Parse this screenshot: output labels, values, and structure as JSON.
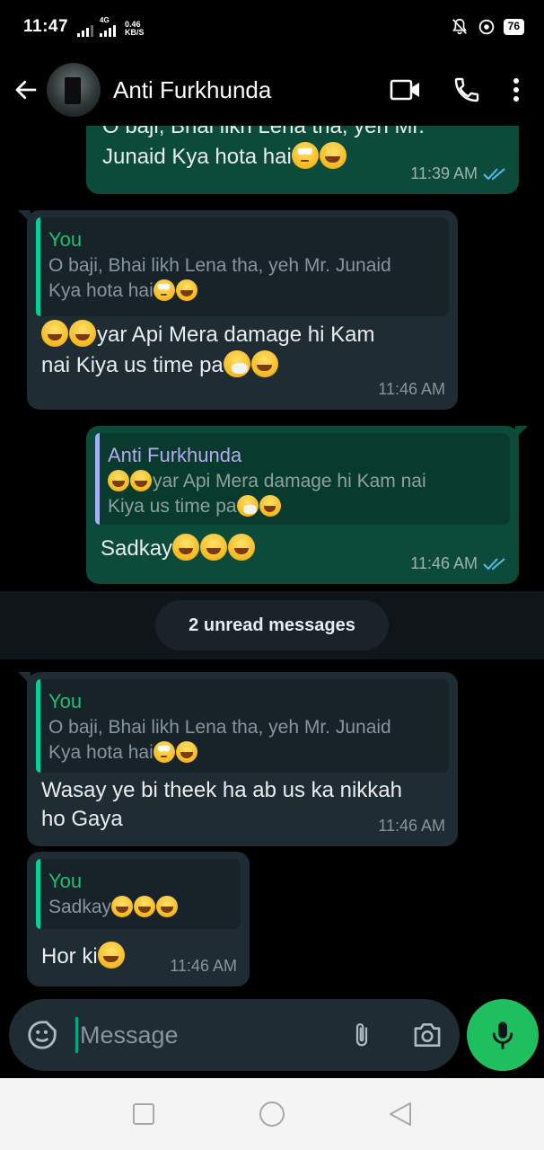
{
  "status_bar": {
    "time": "11:47",
    "network_type": "4G",
    "net_speed_value": "0.46",
    "net_speed_unit": "KB/S",
    "battery": "76"
  },
  "header": {
    "contact_name": "Anti Furkhunda",
    "icons": [
      "back-arrow-icon",
      "video-call-icon",
      "phone-icon",
      "more-vert-icon"
    ]
  },
  "messages": [
    {
      "direction": "out",
      "text_line1": "O baji, Bhai likh Lena tha,  yeh Mr.",
      "text_line2": "Junaid Kya hota hai",
      "time": "11:39 AM",
      "status": "read"
    },
    {
      "direction": "in",
      "quote_author": "You",
      "quote_line1": "O baji, Bhai likh Lena tha,  yeh Mr. Junaid",
      "quote_line2": "Kya hota hai",
      "text_line1": "yar Api Mera damage hi Kam",
      "text_line2": "nai Kiya us time pa",
      "time": "11:46 AM"
    },
    {
      "direction": "out",
      "quote_author": "Anti Furkhunda",
      "quote_line1": "yar Api Mera damage hi Kam nai",
      "quote_line2": "Kiya us time pa",
      "text": "Sadkay",
      "time": "11:46 AM",
      "status": "read"
    },
    {
      "direction": "in",
      "quote_author": "You",
      "quote_line1": "O baji, Bhai likh Lena tha,  yeh Mr. Junaid",
      "quote_line2": "Kya hota hai",
      "text_line1": "Wasay ye bi theek ha ab us ka nikkah",
      "text_line2": "ho Gaya",
      "time": "11:46 AM"
    },
    {
      "direction": "in",
      "quote_author": "You",
      "quote_line1": "Sadkay",
      "text": "Hor ki",
      "time": "11:46 AM"
    }
  ],
  "unread_divider": "2 unread messages",
  "composer": {
    "placeholder": "Message",
    "icons": [
      "sticker-icon",
      "attach-icon",
      "camera-icon",
      "mic-icon"
    ]
  },
  "colors": {
    "outgoing_bubble": "#0c4b3a",
    "incoming_bubble": "#202c33",
    "accent": "#1fbf60",
    "read_ticks": "#53bdeb"
  }
}
